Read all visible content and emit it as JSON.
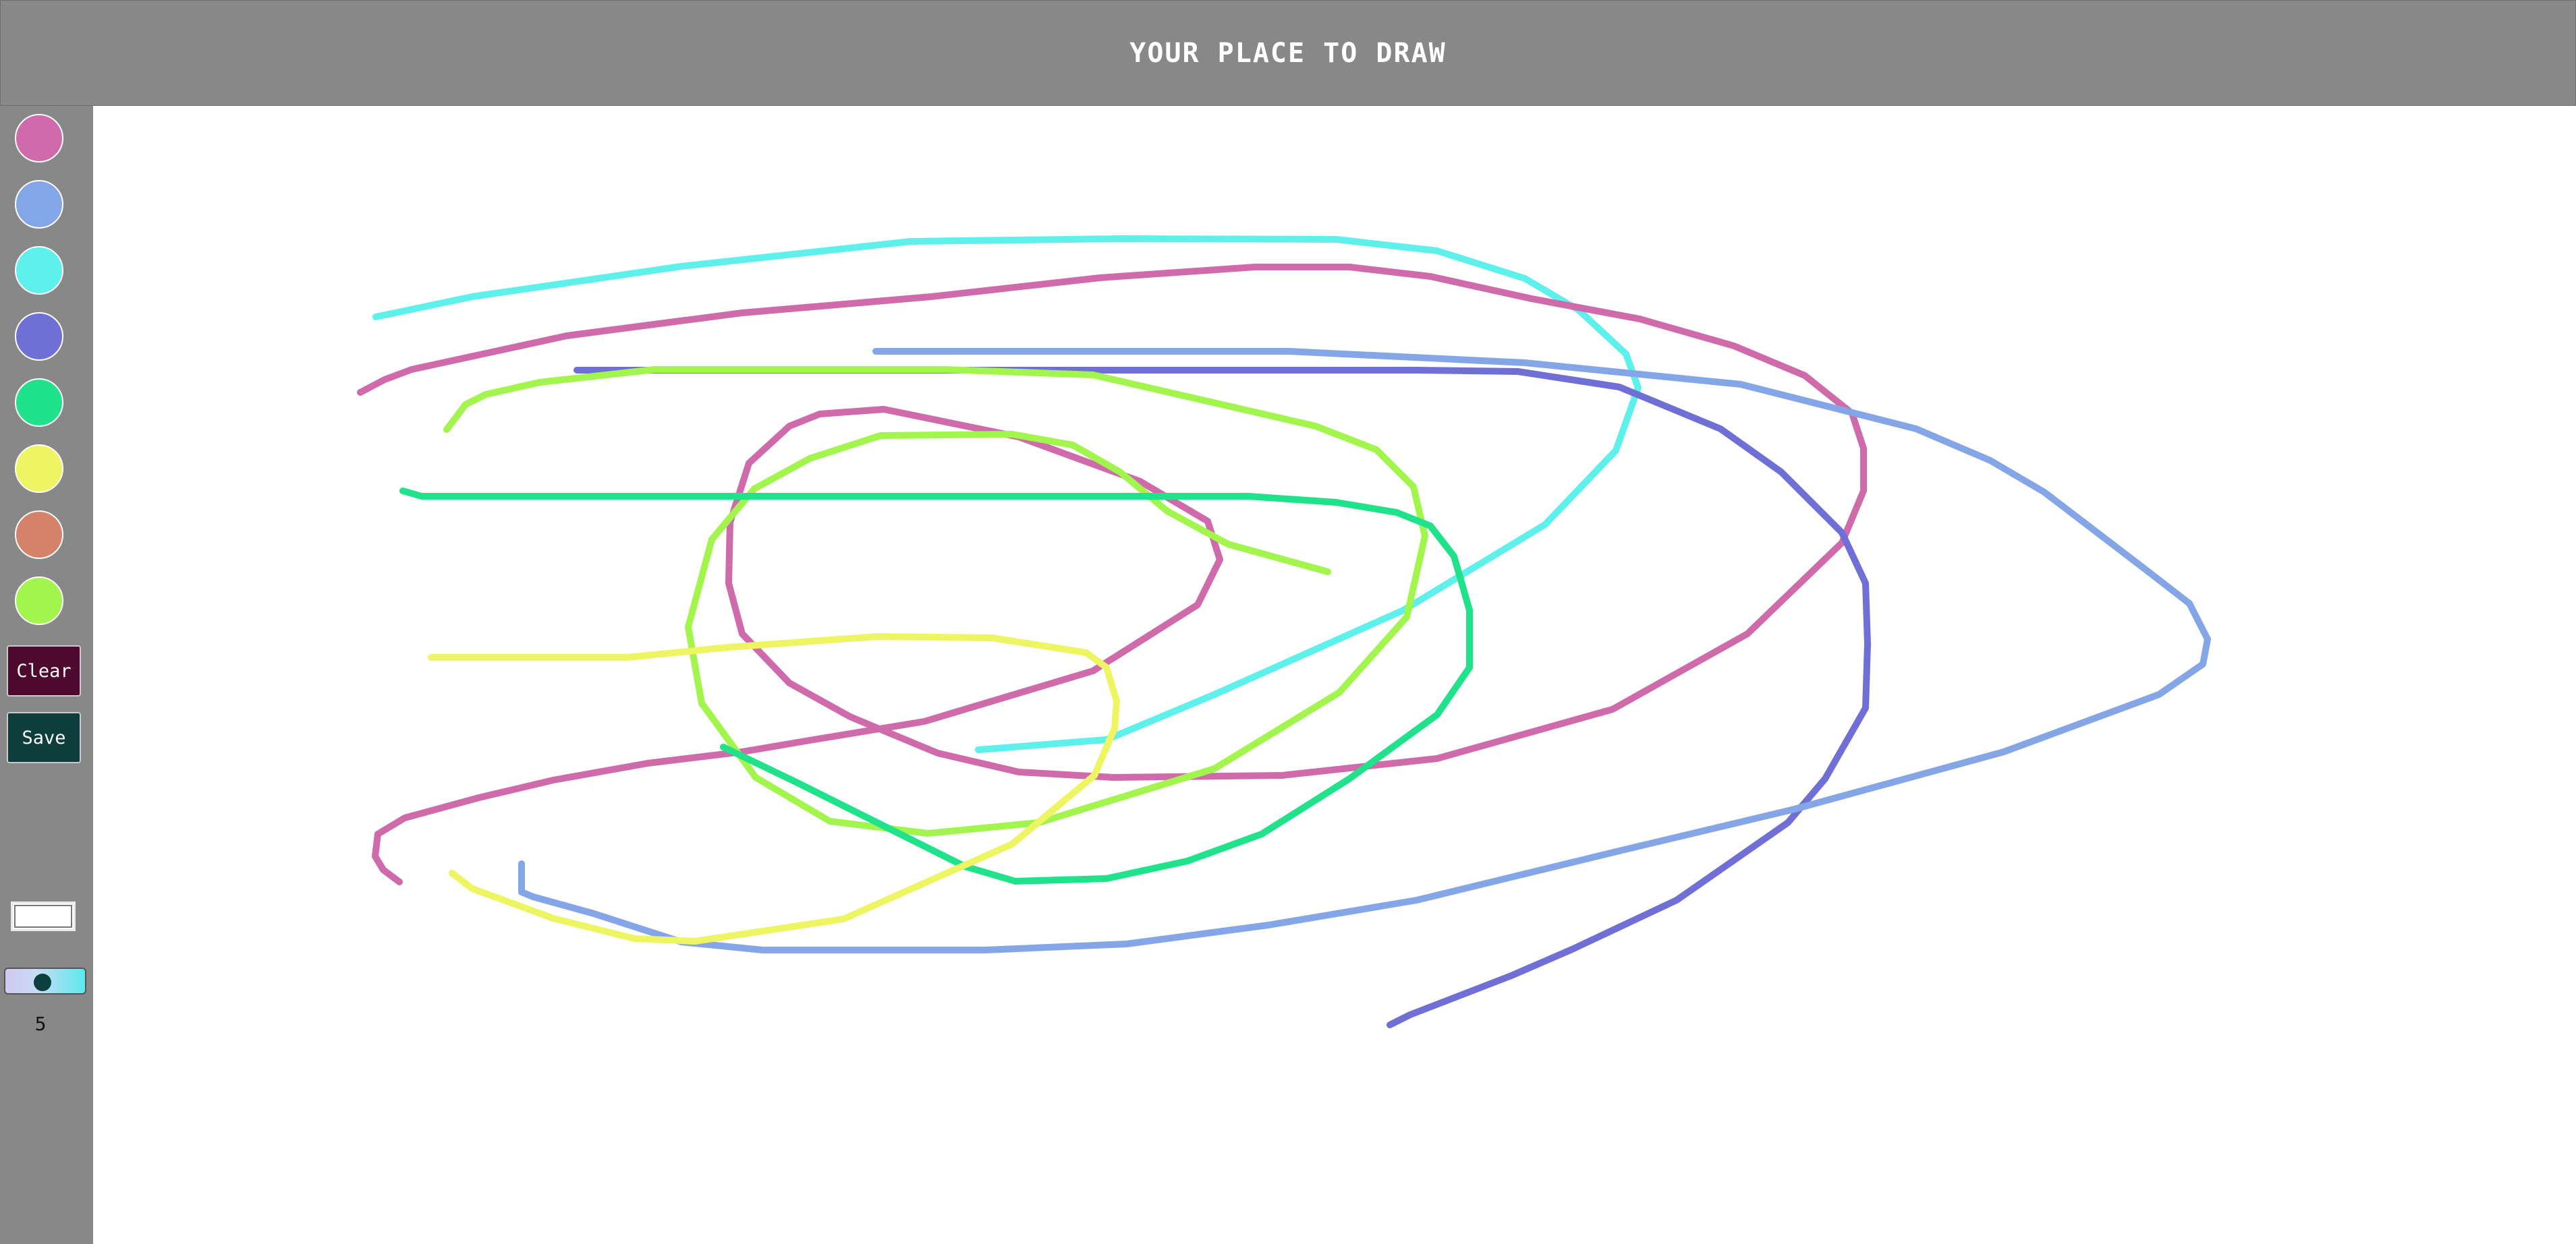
{
  "header": {
    "title": "YOUR PLACE TO DRAW"
  },
  "palette": [
    {
      "name": "pink",
      "color": "#cf6aab"
    },
    {
      "name": "light-blue",
      "color": "#85a6e6"
    },
    {
      "name": "cyan",
      "color": "#5ef0ea"
    },
    {
      "name": "blue-violet",
      "color": "#6f6fd6"
    },
    {
      "name": "green",
      "color": "#1fe28a"
    },
    {
      "name": "yellow",
      "color": "#eef562"
    },
    {
      "name": "salmon",
      "color": "#d4826a"
    },
    {
      "name": "lime",
      "color": "#a1f54c"
    }
  ],
  "toolbar": {
    "clear_label": "Clear",
    "clear_color": "#4d0a2e",
    "save_label": "Save",
    "save_color": "#0e3e3c"
  },
  "brush": {
    "size": 5,
    "size_label": "5"
  },
  "strokes_colors": {
    "cyan": "#5ef0ea",
    "pink": "#cf6aab",
    "blue": "#6f6fd6",
    "light_blue": "#85a6e6",
    "lime": "#a1f54c",
    "green": "#1fe28a",
    "yellow": "#eef562"
  }
}
